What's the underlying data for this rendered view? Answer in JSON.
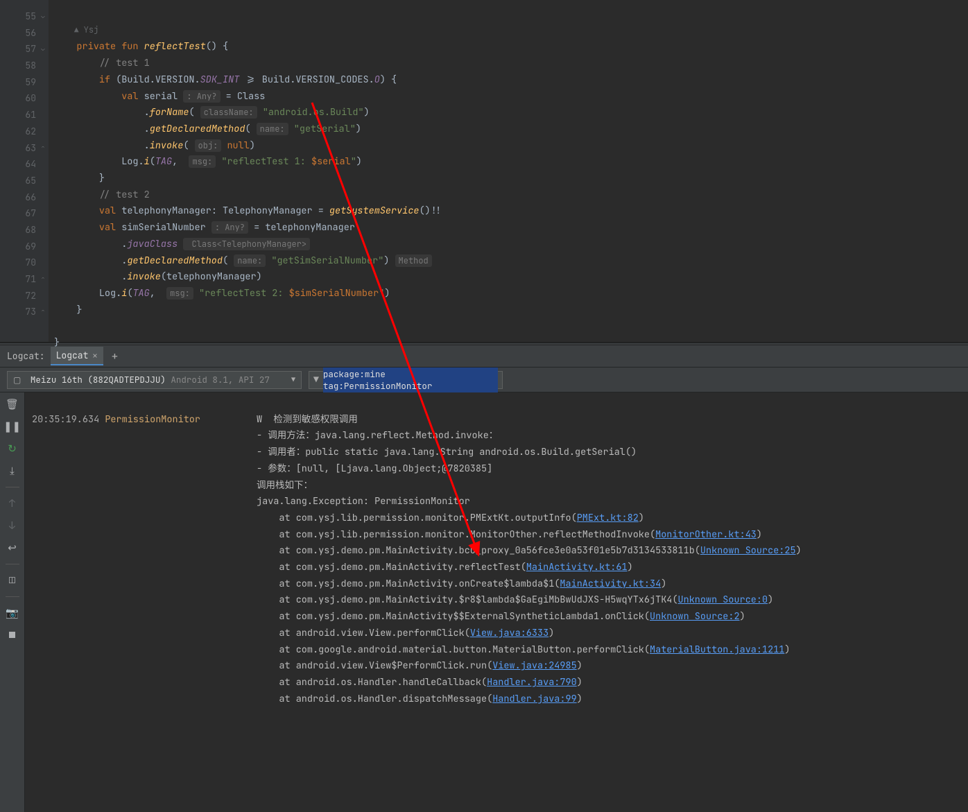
{
  "editor": {
    "author_hint": "Ysj",
    "lines": {
      "55": {
        "indent": "    ",
        "t1": "private fun ",
        "fn": "reflectTest",
        "t2": "() {"
      },
      "56": {
        "indent": "        ",
        "comment": "// test 1"
      },
      "57": {
        "indent": "        ",
        "t1": "if ",
        "t2": "(Build.VERSION.",
        "purple": "SDK_INT",
        "t3": " >= Build.VERSION_CODES.",
        "purple2": "O",
        "t4": ") {"
      },
      "58": {
        "indent": "            ",
        "kw": "val ",
        "id": "serial ",
        "hint": ": Any?",
        "t2": " = Class"
      },
      "59": {
        "indent": "                ",
        "t1": ".",
        "fn": "forName",
        "t2": "( ",
        "hint": "className:",
        "str": "\"android.os.Build\"",
        "t3": ")"
      },
      "60": {
        "indent": "                ",
        "t1": ".",
        "fn": "getDeclaredMethod",
        "t2": "( ",
        "hint": "name:",
        "str": "\"getSerial\"",
        "t3": ")"
      },
      "61": {
        "indent": "                ",
        "t1": ".",
        "fn": "invoke",
        "t2": "( ",
        "hint": "obj:",
        "kw2": "null",
        "t3": ")"
      },
      "62": {
        "indent": "            ",
        "t1": "Log.",
        "fn": "i",
        "t2": "(",
        "purple": "TAG",
        "t3": ",  ",
        "hint": "msg:",
        "str": "\"reflectTest 1: ",
        "varref": "$serial",
        "str2": "\"",
        "t4": ")"
      },
      "63": {
        "indent": "        ",
        "t1": "}"
      },
      "64": {
        "indent": "        ",
        "comment": "// test 2"
      },
      "65": {
        "indent": "        ",
        "kw": "val ",
        "id": "telephonyManager: TelephonyManager = ",
        "fn": "getSystemService",
        "t2": "()!!"
      },
      "66": {
        "indent": "        ",
        "kw": "val ",
        "id": "simSerialNumber ",
        "hint": ": Any?",
        "t2": " = telephonyManager"
      },
      "67": {
        "indent": "            ",
        "t1": ".",
        "purple": "javaClass",
        "hint": " Class<TelephonyManager>"
      },
      "68": {
        "indent": "            ",
        "t1": ".",
        "fn": "getDeclaredMethod",
        "t2": "( ",
        "hint": "name:",
        "str": "\"getSimSerialNumber\"",
        "t3": ") ",
        "hint2": "Method"
      },
      "69": {
        "indent": "            ",
        "t1": ".",
        "fn": "invoke",
        "t2": "(telephonyManager)"
      },
      "70": {
        "indent": "        ",
        "t1": "Log.",
        "fn": "i",
        "t2": "(",
        "purple": "TAG",
        "t3": ",  ",
        "hint": "msg:",
        "str": "\"reflectTest 2: ",
        "varref": "$simSerialNumber",
        "str2": "\"",
        "t4": ")"
      },
      "71": {
        "indent": "    ",
        "t1": "}"
      },
      "72": {
        "indent": ""
      },
      "73": {
        "indent": "",
        "t1": "}"
      }
    },
    "line_numbers": [
      "55",
      "56",
      "57",
      "58",
      "59",
      "60",
      "61",
      "62",
      "63",
      "64",
      "65",
      "66",
      "67",
      "68",
      "69",
      "70",
      "71",
      "72",
      "73"
    ]
  },
  "logcat": {
    "panel_label": "Logcat:",
    "tab_label": "Logcat",
    "device_name": "Meizu 16th (882QADTEPDJJU)",
    "device_sub": "Android 8.1, API 27",
    "filter_prefix": "package:mine ",
    "filter_hl": "tag:PermissionMonitor",
    "output": {
      "ts": "20:35:19.634",
      "tag": "PermissionMonitor",
      "level": "W",
      "lines": [
        "检测到敏感权限调用",
        "- 调用方法：java.lang.reflect.Method.invoke：",
        "- 调用者：public static java.lang.String android.os.Build.getSerial()",
        "- 参数：[null, [Ljava.lang.Object;@7820385]",
        "调用栈如下：",
        "java.lang.Exception: PermissionMonitor"
      ],
      "stack": [
        {
          "pre": "    at com.ysj.lib.permission.monitor.PMExtKt.outputInfo(",
          "link": "PMExt.kt:82",
          "post": ")"
        },
        {
          "pre": "    at com.ysj.lib.permission.monitor.MonitorOther.reflectMethodInvoke(",
          "link": "MonitorOther.kt:43",
          "post": ")"
        },
        {
          "pre": "    at com.ysj.demo.pm.MainActivity.bcu_proxy_0a56fce3e0a53f01e5b7d3134533811b(",
          "link": "Unknown Source:25",
          "post": ")"
        },
        {
          "pre": "    at com.ysj.demo.pm.MainActivity.reflectTest(",
          "link": "MainActivity.kt:61",
          "post": ")"
        },
        {
          "pre": "    at com.ysj.demo.pm.MainActivity.onCreate$lambda$1(",
          "link": "MainActivity.kt:34",
          "post": ")"
        },
        {
          "pre": "    at com.ysj.demo.pm.MainActivity.$r8$lambda$GaEgiMbBwUdJXS-H5wqYTx6jTK4(",
          "link": "Unknown Source:0",
          "post": ")"
        },
        {
          "pre": "    at com.ysj.demo.pm.MainActivity$$ExternalSyntheticLambda1.onClick(",
          "link": "Unknown Source:2",
          "post": ")"
        },
        {
          "pre": "    at android.view.View.performClick(",
          "link": "View.java:6333",
          "post": ")"
        },
        {
          "pre": "    at com.google.android.material.button.MaterialButton.performClick(",
          "link": "MaterialButton.java:1211",
          "post": ")"
        },
        {
          "pre": "    at android.view.View$PerformClick.run(",
          "link": "View.java:24985",
          "post": ")"
        },
        {
          "pre": "    at android.os.Handler.handleCallback(",
          "link": "Handler.java:790",
          "post": ")"
        },
        {
          "pre": "    at android.os.Handler.dispatchMessage(",
          "link": "Handler.java:99",
          "post": ")"
        }
      ]
    }
  }
}
